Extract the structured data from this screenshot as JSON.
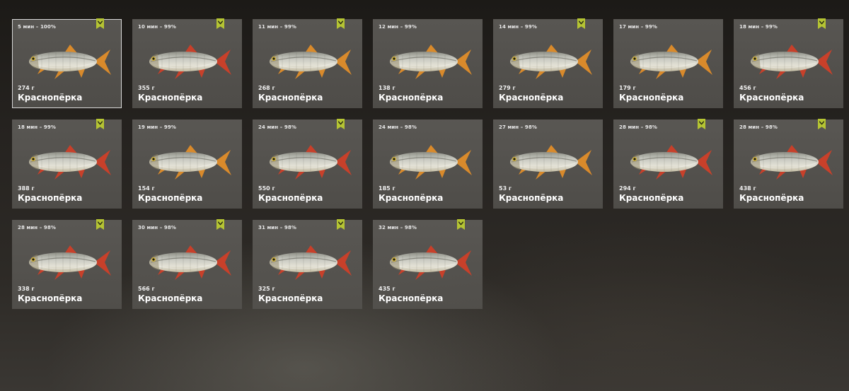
{
  "colors": {
    "badge": "#b5c433",
    "card_bg": "#5d5b57",
    "fin_red": "#c8402a",
    "fin_orange": "#d98a2b"
  },
  "catches": [
    {
      "time": "5 мин – 100%",
      "weight": "274 г",
      "name": "Краснопёрка",
      "tracked": true,
      "selected": true,
      "fin": "orange",
      "icon": "fish-icon"
    },
    {
      "time": "10 мин – 99%",
      "weight": "355 г",
      "name": "Краснопёрка",
      "tracked": true,
      "selected": false,
      "fin": "red",
      "icon": "fish-icon"
    },
    {
      "time": "11 мин – 99%",
      "weight": "268 г",
      "name": "Краснопёрка",
      "tracked": true,
      "selected": false,
      "fin": "orange",
      "icon": "fish-icon"
    },
    {
      "time": "12 мин – 99%",
      "weight": "138 г",
      "name": "Краснопёрка",
      "tracked": false,
      "selected": false,
      "fin": "orange",
      "icon": "fish-icon"
    },
    {
      "time": "14 мин – 99%",
      "weight": "279 г",
      "name": "Краснопёрка",
      "tracked": true,
      "selected": false,
      "fin": "orange",
      "icon": "fish-icon"
    },
    {
      "time": "17 мин – 99%",
      "weight": "179 г",
      "name": "Краснопёрка",
      "tracked": false,
      "selected": false,
      "fin": "orange",
      "icon": "fish-icon"
    },
    {
      "time": "18 мин – 99%",
      "weight": "456 г",
      "name": "Краснопёрка",
      "tracked": true,
      "selected": false,
      "fin": "red",
      "icon": "fish-icon"
    },
    {
      "time": "18 мин – 99%",
      "weight": "388 г",
      "name": "Краснопёрка",
      "tracked": true,
      "selected": false,
      "fin": "red",
      "icon": "fish-icon"
    },
    {
      "time": "19 мин – 99%",
      "weight": "154 г",
      "name": "Краснопёрка",
      "tracked": false,
      "selected": false,
      "fin": "orange",
      "icon": "fish-icon"
    },
    {
      "time": "24 мин – 98%",
      "weight": "550 г",
      "name": "Краснопёрка",
      "tracked": true,
      "selected": false,
      "fin": "red",
      "icon": "fish-icon"
    },
    {
      "time": "24 мин – 98%",
      "weight": "185 г",
      "name": "Краснопёрка",
      "tracked": false,
      "selected": false,
      "fin": "orange",
      "icon": "fish-icon"
    },
    {
      "time": "27 мин – 98%",
      "weight": "53 г",
      "name": "Краснопёрка",
      "tracked": false,
      "selected": false,
      "fin": "orange",
      "icon": "fish-icon"
    },
    {
      "time": "28 мин – 98%",
      "weight": "294 г",
      "name": "Краснопёрка",
      "tracked": true,
      "selected": false,
      "fin": "red",
      "icon": "fish-icon"
    },
    {
      "time": "28 мин – 98%",
      "weight": "438 г",
      "name": "Краснопёрка",
      "tracked": true,
      "selected": false,
      "fin": "red",
      "icon": "fish-icon"
    },
    {
      "time": "28 мин – 98%",
      "weight": "338 г",
      "name": "Краснопёрка",
      "tracked": true,
      "selected": false,
      "fin": "red",
      "icon": "fish-icon"
    },
    {
      "time": "30 мин – 98%",
      "weight": "566 г",
      "name": "Краснопёрка",
      "tracked": true,
      "selected": false,
      "fin": "red",
      "icon": "fish-icon"
    },
    {
      "time": "31 мин – 98%",
      "weight": "325 г",
      "name": "Краснопёрка",
      "tracked": true,
      "selected": false,
      "fin": "red",
      "icon": "fish-icon"
    },
    {
      "time": "32 мин – 98%",
      "weight": "435 г",
      "name": "Краснопёрка",
      "tracked": true,
      "selected": false,
      "fin": "red",
      "icon": "fish-icon"
    }
  ]
}
